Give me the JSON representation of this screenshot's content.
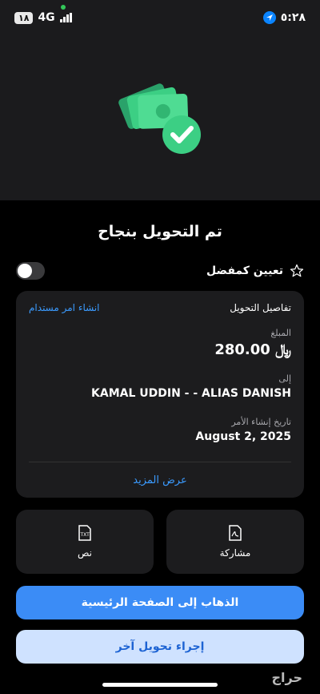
{
  "status_bar": {
    "time": "٥:٢٨",
    "network": "4G",
    "battery": "١٨"
  },
  "title": "تم التحويل بنجاح",
  "favorite": {
    "label": "تعيين كمفضل"
  },
  "details": {
    "header": "تفاصيل التحويل",
    "create_order_link": "انشاء امر مستدام",
    "amount_label": "المبلغ",
    "amount_value": "280.00",
    "amount_currency": "﷼",
    "to_label": "إلى",
    "to_value": "KAMAL UDDIN - - ALIAS DANISH",
    "date_label": "تاريخ إنشاء الأمر",
    "date_value": "August 2, 2025",
    "show_more": "عرض المزيد"
  },
  "actions": {
    "share": "مشاركة",
    "text": "نص"
  },
  "buttons": {
    "home": "الذهاب إلى الصفحة الرئيسية",
    "another_transfer": "إجراء تحويل آخر"
  },
  "watermark": "حراج",
  "colors": {
    "accent": "#3b8cf6",
    "link": "#3b9bff",
    "success": "#3ccf84"
  },
  "icons": [
    "navigation-icon",
    "signal-icon",
    "battery-icon",
    "money-check-icon",
    "star-icon",
    "pdf-icon",
    "txt-icon"
  ]
}
